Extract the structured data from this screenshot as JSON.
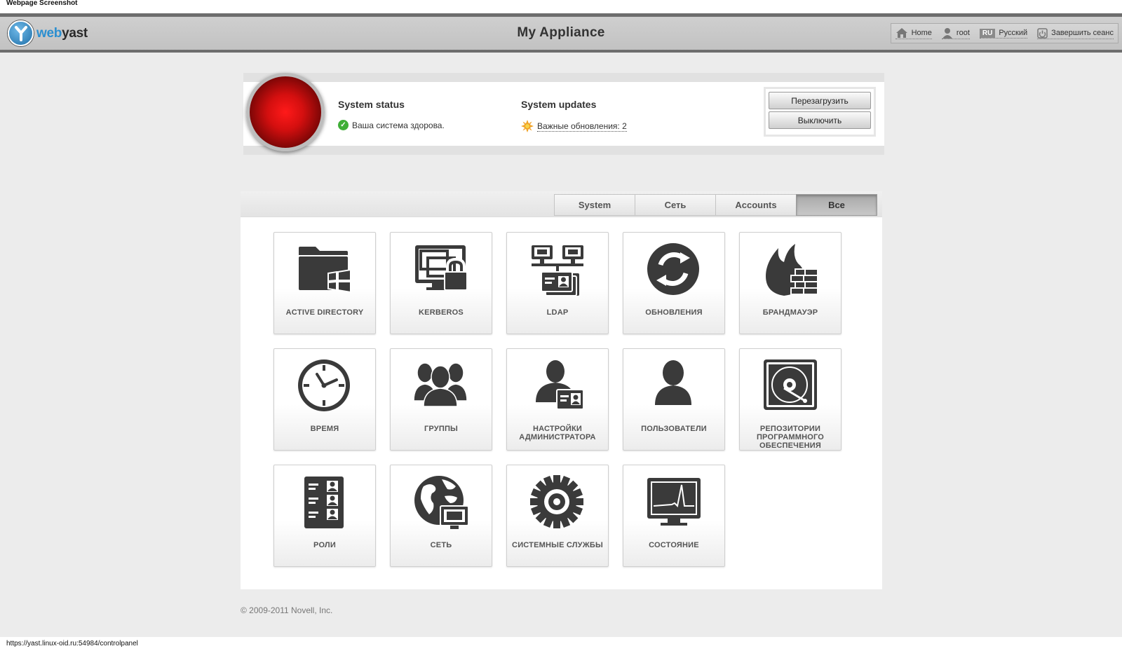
{
  "window": {
    "title": "Webpage Screenshot"
  },
  "header": {
    "logo_prefix": "web",
    "logo_suffix": "yast",
    "app_title": "My Appliance",
    "nav": {
      "home": "Home",
      "user": "root",
      "lang_badge": "RU",
      "lang": "Русский",
      "logout": "Завершить сеанс"
    }
  },
  "status": {
    "system_status": {
      "title": "System status",
      "text": "Ваша система здорова."
    },
    "system_updates": {
      "title": "System updates",
      "text": "Важные обновления: 2"
    },
    "reboot_label": "Перезагрузить",
    "shutdown_label": "Выключить",
    "light_color": "#e01010"
  },
  "tabs": [
    {
      "label": "System",
      "active": false
    },
    {
      "label": "Сеть",
      "active": false
    },
    {
      "label": "Accounts",
      "active": false
    },
    {
      "label": "Все",
      "active": true
    }
  ],
  "modules": [
    {
      "label": "ACTIVE DIRECTORY",
      "icon": "active-directory-icon"
    },
    {
      "label": "KERBEROS",
      "icon": "kerberos-icon"
    },
    {
      "label": "LDAP",
      "icon": "ldap-icon"
    },
    {
      "label": "ОБНОВЛЕНИЯ",
      "icon": "updates-icon"
    },
    {
      "label": "БРАНДМАУЭР",
      "icon": "firewall-icon"
    },
    {
      "label": "ВРЕМЯ",
      "icon": "clock-icon"
    },
    {
      "label": "ГРУППЫ",
      "icon": "groups-icon"
    },
    {
      "label": "НАСТРОЙКИ АДМИНИСТРАТОРА",
      "icon": "admin-icon"
    },
    {
      "label": "ПОЛЬЗОВАТЕЛИ",
      "icon": "users-icon"
    },
    {
      "label": "РЕПОЗИТОРИИ ПРОГРАММНОГО ОБЕСПЕЧЕНИЯ",
      "icon": "repositories-icon"
    },
    {
      "label": "РОЛИ",
      "icon": "roles-icon"
    },
    {
      "label": "СЕТЬ",
      "icon": "network-icon"
    },
    {
      "label": "СИСТЕМНЫЕ СЛУЖБЫ",
      "icon": "services-icon"
    },
    {
      "label": "СОСТОЯНИЕ",
      "icon": "status-icon"
    }
  ],
  "footer": {
    "copyright": "© 2009-2011 Novell, Inc."
  },
  "statusbar": {
    "url": "https://yast.linux-oid.ru:54984/controlpanel"
  },
  "colors": {
    "icon": "#3a3a3a",
    "accent": "#2c8fd0",
    "ok": "#3fae37",
    "update": "#f0a020"
  }
}
